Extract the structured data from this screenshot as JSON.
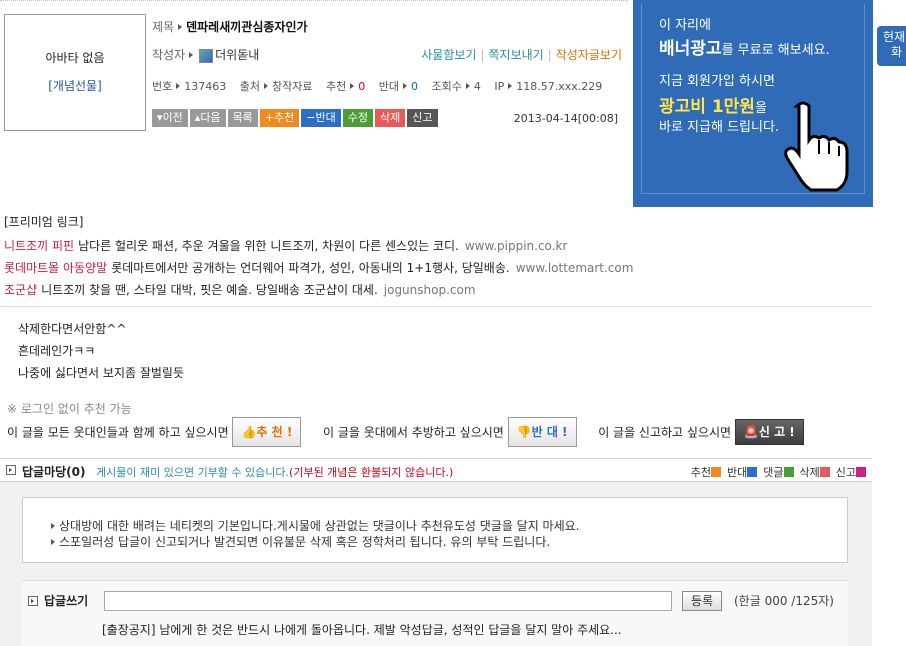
{
  "avatar": {
    "none_text": "아바타 없음",
    "gift_link": "[개념선물]"
  },
  "post": {
    "title_label": "제목",
    "title": "덴파레새끼관심종자인가",
    "author_label": "작성자",
    "author": "더위돋내",
    "links": [
      "사물함보기",
      "쪽지보내기",
      "작성자글보기"
    ],
    "meta": {
      "no_label": "번호",
      "no": "137463",
      "source_label": "출처",
      "source": "창작자료",
      "rec_label": "추천",
      "rec": "0",
      "opp_label": "반대",
      "opp": "0",
      "views_label": "조회수",
      "views": "4",
      "ip_label": "IP",
      "ip": "118.57.xxx.229"
    },
    "buttons": {
      "prev": "이전",
      "next": "다음",
      "list": "목록",
      "recommend": "추천",
      "oppose": "반대",
      "edit": "수정",
      "delete": "삭제",
      "report": "신고"
    },
    "date": "2013-04-14[00:08]",
    "body_lines": [
      "삭제한다면서안함^^",
      "흔데레인가ㅋㅋ",
      "나중에 싫다면서 보지좀 잘벌릴듯"
    ]
  },
  "banner": {
    "line1": "이 자리에",
    "line2_main": "배너광고",
    "line2_rest": "를 무료로 해보세요.",
    "line3": "지금 회원가입 하시면",
    "line4_main": "광고비 1만원",
    "line4_rest": "을",
    "line5": "바로 지급해 드립니다."
  },
  "side_tab": {
    "line1": "현재",
    "line2": "화"
  },
  "premium": {
    "header": "[프리미엄 링크]",
    "items": [
      {
        "name": "니트조끼 피핀",
        "desc": "남다른 헐리웃 패션, 추운 겨울을 위한 니트조끼, 차원이 다른 센스있는 코디.",
        "url": "www.pippin.co.kr"
      },
      {
        "name": "롯데마트몰 아동양말",
        "desc": "롯데마트에서만 공개하는 언더웨어 파격가, 성인, 아동내의 1+1행사, 당일배송.",
        "url": "www.lottemart.com"
      },
      {
        "name": "조군샵",
        "desc": "니트조끼 찾을 땐, 스타일 대박, 핏은 예술. 당일배송 조군샵이 대세.",
        "url": "jogunshop.com"
      }
    ]
  },
  "recommend": {
    "note": "※ 로그인 없이 추천 가능",
    "rec_text": "이 글을 모든 웃대인들과 함께 하고 싶으시면",
    "rec_button": "추 천 !",
    "opp_text": "이 글을 웃대에서 추방하고 싶으시면",
    "opp_button": "반 대 !",
    "report_text": "이 글을 신고하고 싶으시면",
    "report_button": "신 고 !"
  },
  "reply": {
    "title": "답글마당(0)",
    "subtitle": "게시물이 재미 있으면 기부할 수 있습니다.",
    "subtitle_red": "(기부된 개념은 환불되지 않습니다.)",
    "legend": [
      {
        "label": "추천",
        "color": "#f08a1c"
      },
      {
        "label": "반대",
        "color": "#2b6fc6"
      },
      {
        "label": "댓글",
        "color": "#4b9e37"
      },
      {
        "label": "삭제",
        "color": "#e85a5a"
      },
      {
        "label": "신고",
        "color": "#cc2288"
      }
    ],
    "notice": [
      "상대방에 대한 배려는 네티켓의 기본입니다.게시물에 상관없는 댓글이나 추천유도성 댓글을 달지 마세요.",
      "스포일러성 답글이 신고되거나 발견되면 이유불문 삭제 혹은 정학처리 됩니다. 유의 부탁 드립니다."
    ],
    "write_label": "답글쓰기",
    "input_value": "",
    "submit": "등록",
    "counter": "(한글 000 /125자)",
    "warning": "[출장공지] 남에게 한 것은 반드시 나에게 돌아옵니다. 제발 악성답글, 성적인 답글을 달지 말아 주세요..."
  }
}
